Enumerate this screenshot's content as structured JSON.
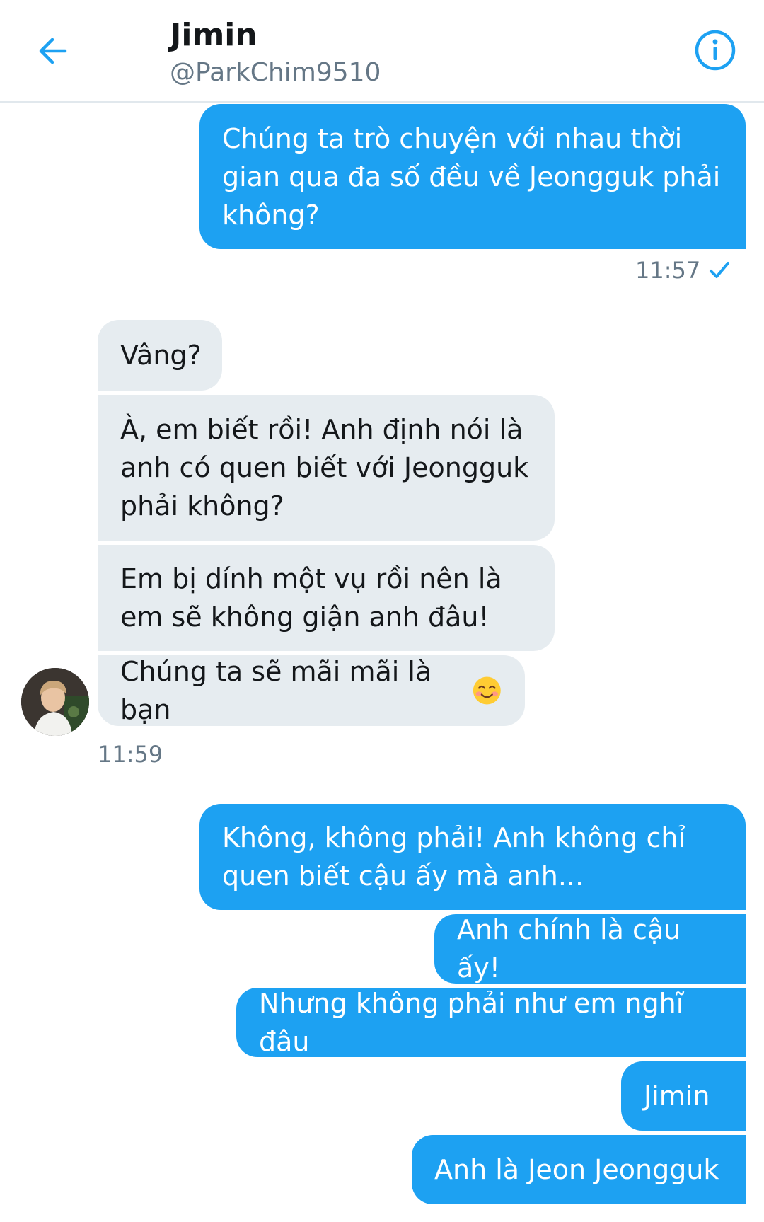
{
  "header": {
    "title": "Jimin",
    "handle": "@ParkChim9510",
    "accent": "#1da1f2"
  },
  "messages": {
    "m1": "Chúng ta trò chuyện với nhau thời gian qua đa số đều về Jeongguk phải không?",
    "t1": "11:57",
    "m2": "Vâng?",
    "m3": "À, em biết rồi! Anh định nói là anh có quen biết với Jeongguk phải không?",
    "m4": "Em bị dính một vụ rồi nên là em sẽ không giận anh đâu!",
    "m5": "Chúng ta sẽ mãi mãi là bạn",
    "t2": "11:59",
    "m6": "Không, không phải! Anh không chỉ quen biết cậu ấy mà anh...",
    "m7": "Anh chính là cậu ấy!",
    "m8": "Nhưng không phải như em nghĩ đâu",
    "m9": "Jimin",
    "m10": "Anh là Jeon Jeongguk"
  },
  "icons": {
    "back": "back-arrow-icon",
    "info": "info-icon",
    "read": "checkmark-icon",
    "emoji": "smiling-face-emoji",
    "avatar": "profile-photo"
  },
  "colors": {
    "outgoing_bubble": "#1da1f2",
    "incoming_bubble": "#e6ecf0",
    "muted_text": "#657786"
  }
}
